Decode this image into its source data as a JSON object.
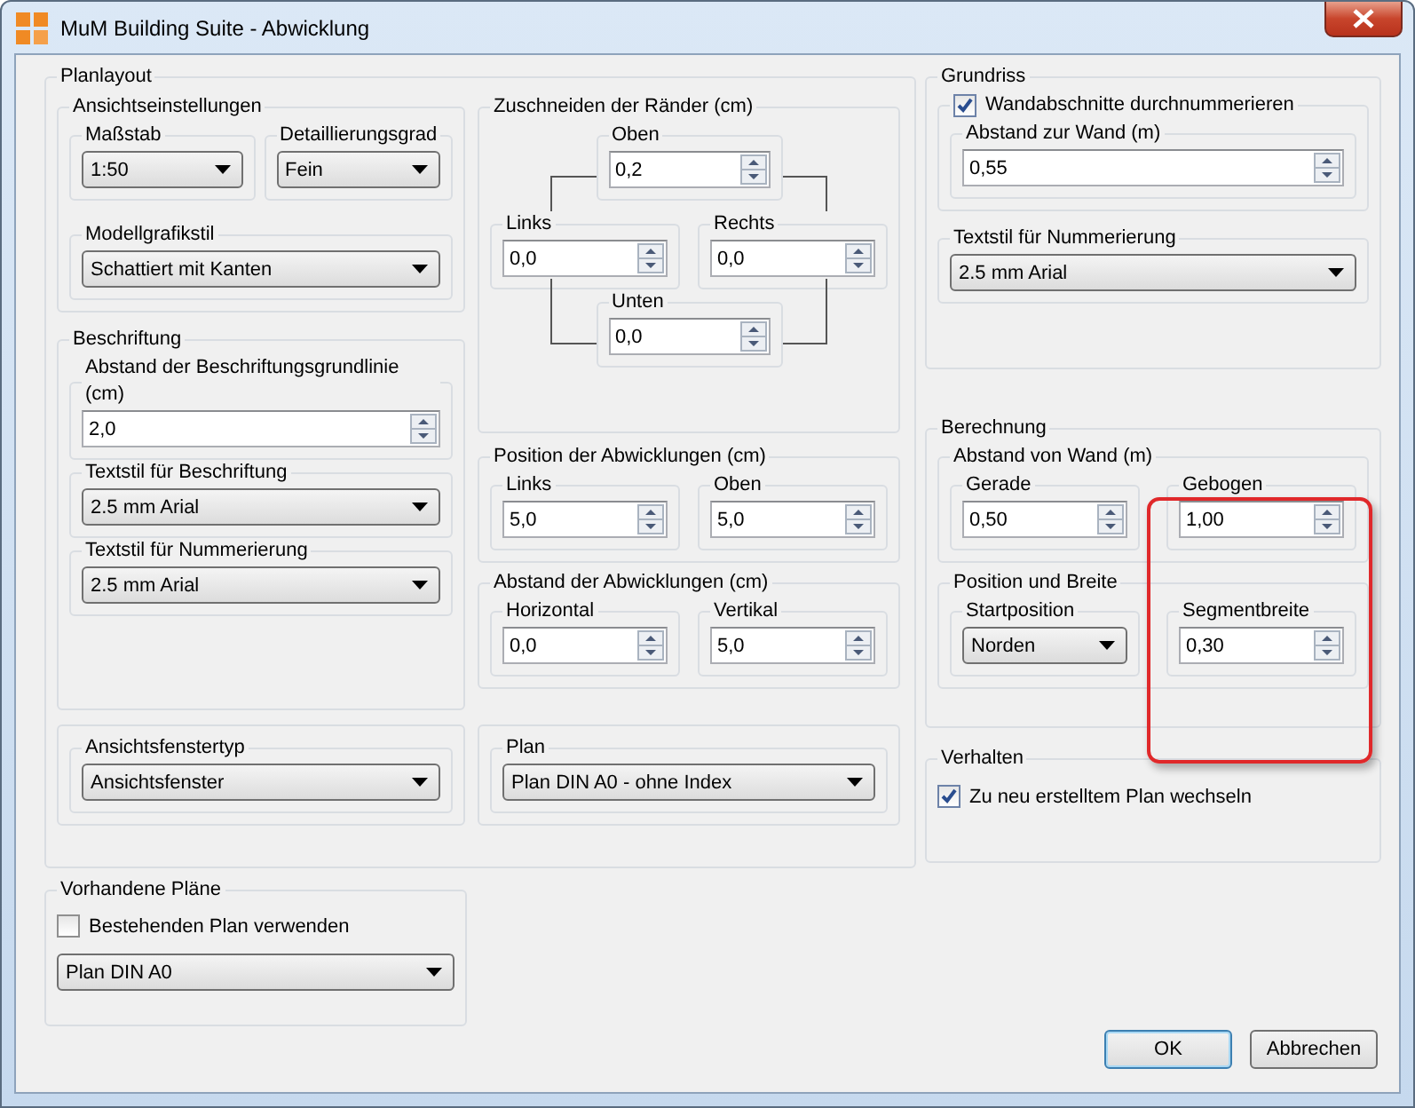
{
  "window": {
    "title": "MuM Building Suite - Abwicklung"
  },
  "planlayout": {
    "title": "Planlayout",
    "ansicht": {
      "title": "Ansichtseinstellungen",
      "massstab": {
        "label": "Maßstab",
        "value": "1:50"
      },
      "detail": {
        "label": "Detaillierungsgrad",
        "value": "Fein"
      },
      "modell": {
        "label": "Modellgrafikstil",
        "value": "Schattiert mit Kanten"
      }
    },
    "beschriftung": {
      "title": "Beschriftung",
      "abstand": {
        "label": "Abstand der Beschriftungsgrundlinie (cm)",
        "value": "2,0"
      },
      "textstil": {
        "label": "Textstil für Beschriftung",
        "value": "2.5 mm Arial"
      },
      "nummerierung": {
        "label": "Textstil für Nummerierung",
        "value": "2.5 mm Arial"
      }
    },
    "raender": {
      "title": "Zuschneiden der Ränder (cm)",
      "oben": {
        "label": "Oben",
        "value": "0,2"
      },
      "links": {
        "label": "Links",
        "value": "0,0"
      },
      "rechts": {
        "label": "Rechts",
        "value": "0,0"
      },
      "unten": {
        "label": "Unten",
        "value": "0,0"
      }
    },
    "position": {
      "title": "Position der Abwicklungen (cm)",
      "links": {
        "label": "Links",
        "value": "5,0"
      },
      "oben": {
        "label": "Oben",
        "value": "5,0"
      }
    },
    "abstand": {
      "title": "Abstand der Abwicklungen (cm)",
      "horizontal": {
        "label": "Horizontal",
        "value": "0,0"
      },
      "vertikal": {
        "label": "Vertikal",
        "value": "5,0"
      }
    },
    "fenstertyp": {
      "label": "Ansichtsfenstertyp",
      "value": "Ansichtsfenster"
    },
    "plan": {
      "label": "Plan",
      "value": "Plan DIN A0 - ohne Index"
    }
  },
  "vorhandene": {
    "title": "Vorhandene Pläne",
    "checkbox": {
      "label": "Bestehenden Plan verwenden",
      "checked": false
    },
    "plan": {
      "value": "Plan DIN A0"
    }
  },
  "grundriss": {
    "title": "Grundriss",
    "checkbox": {
      "label": "Wandabschnitte durchnummerieren",
      "checked": true
    },
    "abstand": {
      "label": "Abstand zur Wand (m)",
      "value": "0,55"
    },
    "textstil": {
      "label": "Textstil für Nummerierung",
      "value": "2.5 mm Arial"
    }
  },
  "berechnung": {
    "title": "Berechnung",
    "highlight": true,
    "wand": {
      "title": "Abstand von Wand (m)",
      "gerade": {
        "label": "Gerade",
        "value": "0,50"
      },
      "gebogen": {
        "label": "Gebogen",
        "value": "1,00"
      }
    },
    "pos": {
      "title": "Position und Breite",
      "start": {
        "label": "Startposition",
        "value": "Norden"
      },
      "segment": {
        "label": "Segmentbreite",
        "value": "0,30"
      }
    }
  },
  "verhalten": {
    "title": "Verhalten",
    "checkbox": {
      "label": "Zu neu erstelltem Plan wechseln",
      "checked": true
    }
  },
  "buttons": [
    {
      "label": "OK",
      "default": true
    },
    {
      "label": "Abbrechen",
      "default": false
    }
  ]
}
